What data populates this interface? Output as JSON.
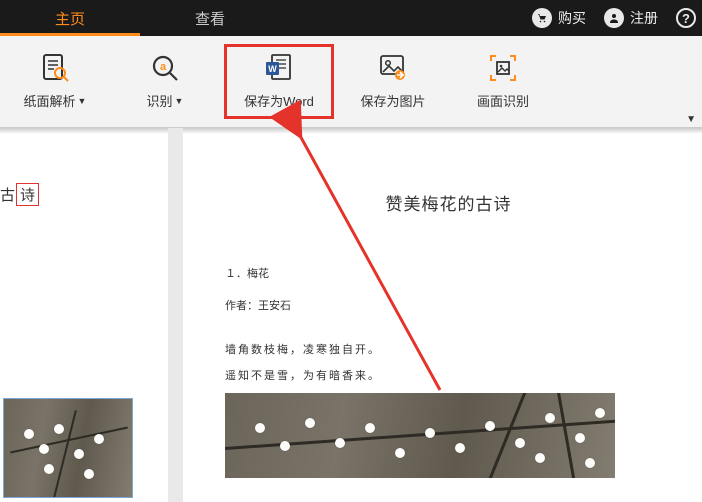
{
  "tabs": {
    "home": "主页",
    "view": "查看"
  },
  "header": {
    "buy": "购买",
    "register": "注册"
  },
  "toolbar": {
    "parse": "纸面解析",
    "recognize": "识别",
    "save_word": "保存为Word",
    "save_image": "保存为图片",
    "screen_ocr": "画面识别"
  },
  "left": {
    "title_a": "古",
    "title_b": "诗"
  },
  "doc": {
    "title": "赞美梅花的古诗",
    "section": "１．梅花",
    "author_label": "作者：",
    "author_name": "王安石",
    "line1": "墙角数枝梅，凌寒独自开。",
    "line2": "遥知不是雪，为有暗香来。"
  }
}
